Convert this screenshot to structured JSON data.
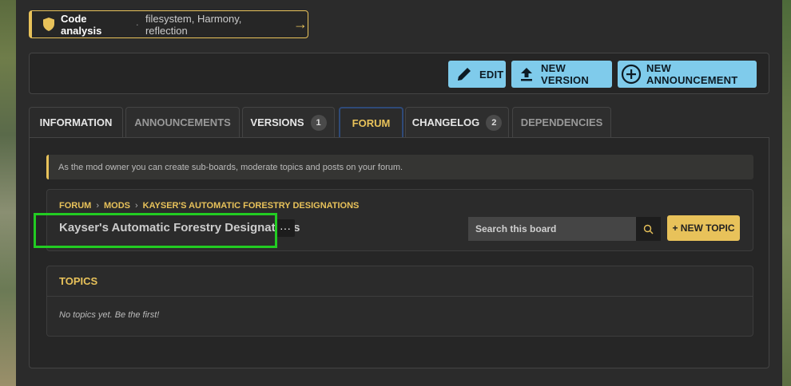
{
  "code_analysis": {
    "title": "Code analysis",
    "separator": "·",
    "tags": "filesystem, Harmony, reflection",
    "arrow": "→",
    "icon": "shield-icon"
  },
  "actions": {
    "edit": "EDIT",
    "new_version": "NEW VERSION",
    "new_announcement": "NEW ANNOUNCEMENT"
  },
  "tabs": [
    {
      "label": "INFORMATION"
    },
    {
      "label": "ANNOUNCEMENTS"
    },
    {
      "label": "VERSIONS",
      "badge": "1"
    },
    {
      "label": "FORUM",
      "active": true
    },
    {
      "label": "CHANGELOG",
      "badge": "2"
    },
    {
      "label": "DEPENDENCIES"
    }
  ],
  "notice": "As the mod owner you can create sub-boards, moderate topics and posts on your forum.",
  "breadcrumb": [
    "FORUM",
    "MODS",
    "KAYSER'S AUTOMATIC FORESTRY DESIGNATIONS"
  ],
  "breadcrumb_sep": "›",
  "board_title": "Kayser's Automatic Forestry Designations",
  "more_label": "···",
  "search": {
    "placeholder": "Search this board"
  },
  "new_topic": "+ NEW TOPIC",
  "topics": {
    "heading": "TOPICS",
    "empty": "No topics yet. Be the first!"
  },
  "colors": {
    "accent": "#e8c25a",
    "button": "#7fcbeb",
    "highlight": "#22cc22",
    "active_tab_border": "#2f4a78"
  }
}
